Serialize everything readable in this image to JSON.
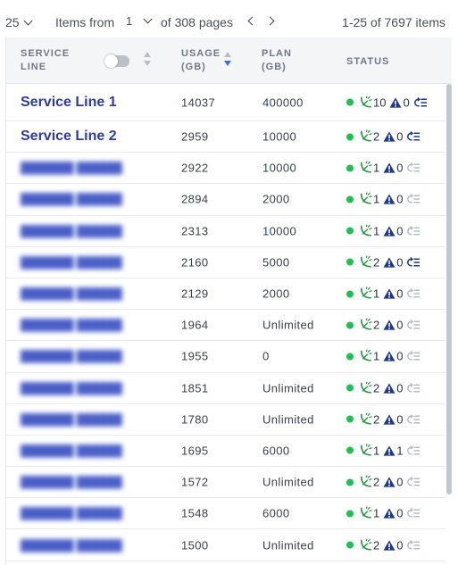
{
  "pager": {
    "page_size": "25",
    "items_from_label": "Items from",
    "page": "1",
    "of_pages_label": "of 308 pages",
    "range_label": "1-25 of 7697 items"
  },
  "columns": {
    "service_line": "SERVICE\nLINE",
    "usage": "USAGE\n(GB)",
    "plan": "PLAN\n(GB)",
    "status": "STATUS"
  },
  "colors": {
    "link": "#2e3aa8",
    "online": "#1fbf53",
    "alert": "#1d3a8a",
    "sort_active": "#3d6fe0"
  },
  "icons": {
    "status": "green-dot-icon",
    "dish": "satellite-dish-icon",
    "alert": "warning-triangle-icon",
    "relist": "refresh-list-icon"
  },
  "rows": [
    {
      "name": "Service Line 1",
      "bold": true,
      "usage": "14037",
      "plan": "400000",
      "dishes": "10",
      "alerts": "0",
      "relist_active": true
    },
    {
      "name": "Service Line 2",
      "bold": true,
      "usage": "2959",
      "plan": "10000",
      "dishes": "2",
      "alerts": "0",
      "relist_active": true
    },
    {
      "name": "",
      "bold": false,
      "usage": "2922",
      "plan": "10000",
      "dishes": "1",
      "alerts": "0",
      "relist_active": false
    },
    {
      "name": "",
      "bold": false,
      "usage": "2894",
      "plan": "2000",
      "dishes": "1",
      "alerts": "0",
      "relist_active": false
    },
    {
      "name": "",
      "bold": false,
      "usage": "2313",
      "plan": "10000",
      "dishes": "1",
      "alerts": "0",
      "relist_active": false
    },
    {
      "name": "",
      "bold": false,
      "usage": "2160",
      "plan": "5000",
      "dishes": "2",
      "alerts": "0",
      "relist_active": true
    },
    {
      "name": "",
      "bold": false,
      "usage": "2129",
      "plan": "2000",
      "dishes": "1",
      "alerts": "0",
      "relist_active": false
    },
    {
      "name": "",
      "bold": false,
      "usage": "1964",
      "plan": "Unlimited",
      "dishes": "2",
      "alerts": "0",
      "relist_active": false
    },
    {
      "name": "",
      "bold": false,
      "usage": "1955",
      "plan": "0",
      "dishes": "1",
      "alerts": "0",
      "relist_active": false
    },
    {
      "name": "",
      "bold": false,
      "usage": "1851",
      "plan": "Unlimited",
      "dishes": "2",
      "alerts": "0",
      "relist_active": false
    },
    {
      "name": "",
      "bold": false,
      "usage": "1780",
      "plan": "Unlimited",
      "dishes": "2",
      "alerts": "0",
      "relist_active": false
    },
    {
      "name": "",
      "bold": false,
      "usage": "1695",
      "plan": "6000",
      "dishes": "1",
      "alerts": "1",
      "relist_active": false
    },
    {
      "name": "",
      "bold": false,
      "usage": "1572",
      "plan": "Unlimited",
      "dishes": "2",
      "alerts": "0",
      "relist_active": false
    },
    {
      "name": "",
      "bold": false,
      "usage": "1548",
      "plan": "6000",
      "dishes": "1",
      "alerts": "0",
      "relist_active": false
    },
    {
      "name": "",
      "bold": false,
      "usage": "1500",
      "plan": "Unlimited",
      "dishes": "2",
      "alerts": "0",
      "relist_active": false
    }
  ]
}
